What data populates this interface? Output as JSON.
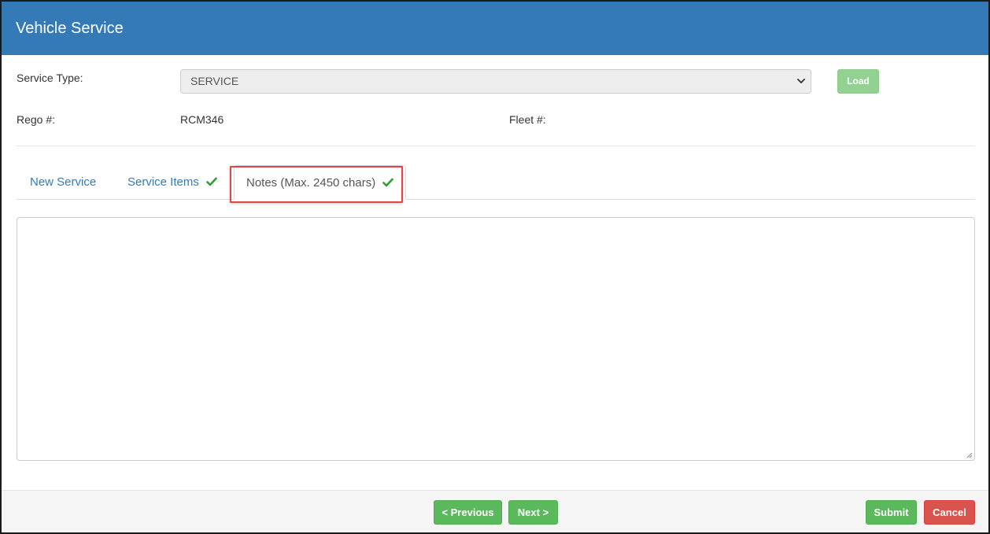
{
  "header": {
    "title": "Vehicle Service"
  },
  "form": {
    "service_type_label": "Service Type:",
    "service_type_value": "SERVICE",
    "load_label": "Load",
    "rego_label": "Rego #:",
    "rego_value": "RCM346",
    "fleet_label": "Fleet #:"
  },
  "tabs": [
    {
      "label": "New Service",
      "checked": false
    },
    {
      "label": "Service Items",
      "checked": true
    },
    {
      "label": "Notes (Max. 2450 chars)",
      "checked": true,
      "active": true
    }
  ],
  "notes": {
    "value": ""
  },
  "footer": {
    "previous_label": "< Previous",
    "next_label": "Next >",
    "submit_label": "Submit",
    "cancel_label": "Cancel"
  },
  "colors": {
    "header": "#337ab7",
    "success": "#5cb85c",
    "danger": "#d9534f",
    "check": "#2e9e2e",
    "highlight": "#e24646"
  }
}
